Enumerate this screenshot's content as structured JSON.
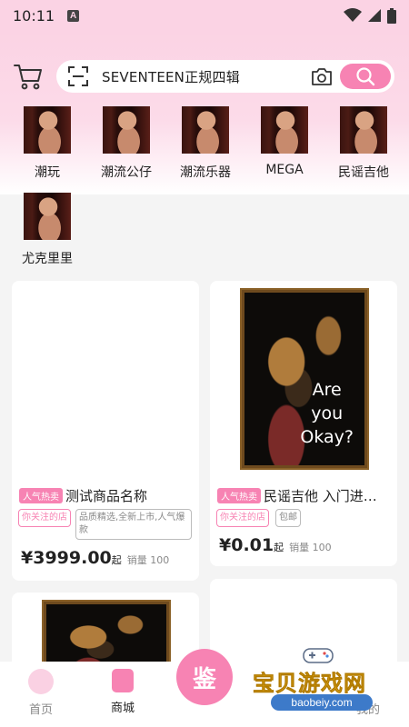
{
  "status_bar": {
    "time": "10:11",
    "a_badge": "A"
  },
  "search": {
    "text": "SEVENTEEN正规四辑"
  },
  "categories": [
    {
      "label": "潮玩"
    },
    {
      "label": "潮流公仔"
    },
    {
      "label": "潮流乐器"
    },
    {
      "label": "MEGA"
    },
    {
      "label": "民谣吉他"
    },
    {
      "label": "尤克里里"
    }
  ],
  "products": [
    {
      "hot_tag": "人气热卖",
      "title": "测试商品名称",
      "chips": [
        "你关注的店",
        "品质精选,全新上市,人气爆款"
      ],
      "price": "¥3999.00",
      "price_suffix": "起",
      "sales": "销量 100"
    },
    {
      "hot_tag": "人气热卖",
      "title": "民谣吉他 入门进…",
      "chips": [
        "你关注的店",
        "包邮"
      ],
      "price": "¥0.01",
      "price_suffix": "起",
      "sales": "销量 100",
      "image_text": [
        "Are",
        "you",
        "Okay?"
      ]
    }
  ],
  "nav": {
    "home": "首页",
    "mall": "商城",
    "center": "鉴",
    "mine": "我的"
  },
  "watermark": {
    "cn": "宝贝游戏网",
    "url": "baobeiy.com"
  },
  "colors": {
    "accent": "#f783b3",
    "header_bg": "#fbd3e4"
  }
}
